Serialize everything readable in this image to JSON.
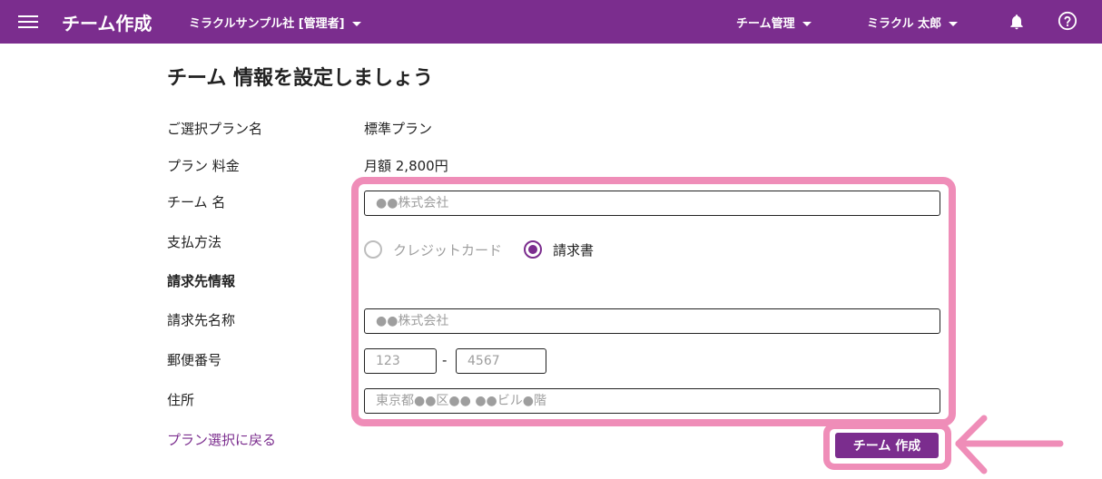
{
  "header": {
    "title": "チーム作成",
    "company": "ミラクルサンプル社 [管理者]",
    "team_menu": "チーム管理",
    "user_menu": "ミラクル 太郎",
    "icons": {
      "menu": "hamburger-icon",
      "bell": "bell-icon",
      "help": "help-icon"
    },
    "color": "#7b2d8e"
  },
  "page_title": "チーム 情報を設定しましょう",
  "form": {
    "plan_name_label": "ご選択プラン名",
    "plan_name_value": "標準プラン",
    "plan_fee_label": "プラン 料金",
    "plan_fee_value": "月額 2,800円",
    "team_name_label": "チーム 名",
    "team_name_placeholder": "●●株式会社",
    "payment_label": "支払方法",
    "payment_options": [
      {
        "label": "クレジットカード",
        "selected": false
      },
      {
        "label": "請求書",
        "selected": true
      }
    ],
    "billing_section_label": "請求先情報",
    "billing_name_label": "請求先名称",
    "billing_name_placeholder": "●●株式会社",
    "postal_label": "郵便番号",
    "postal_part1_placeholder": "123",
    "postal_separator": "-",
    "postal_part2_placeholder": "4567",
    "address_label": "住所",
    "address_placeholder": "東京都●●区●● ●●ビル●階"
  },
  "back_link": "プラン選択に戻る",
  "create_button": "チーム 作成",
  "annotation_color": "#ef8db8"
}
